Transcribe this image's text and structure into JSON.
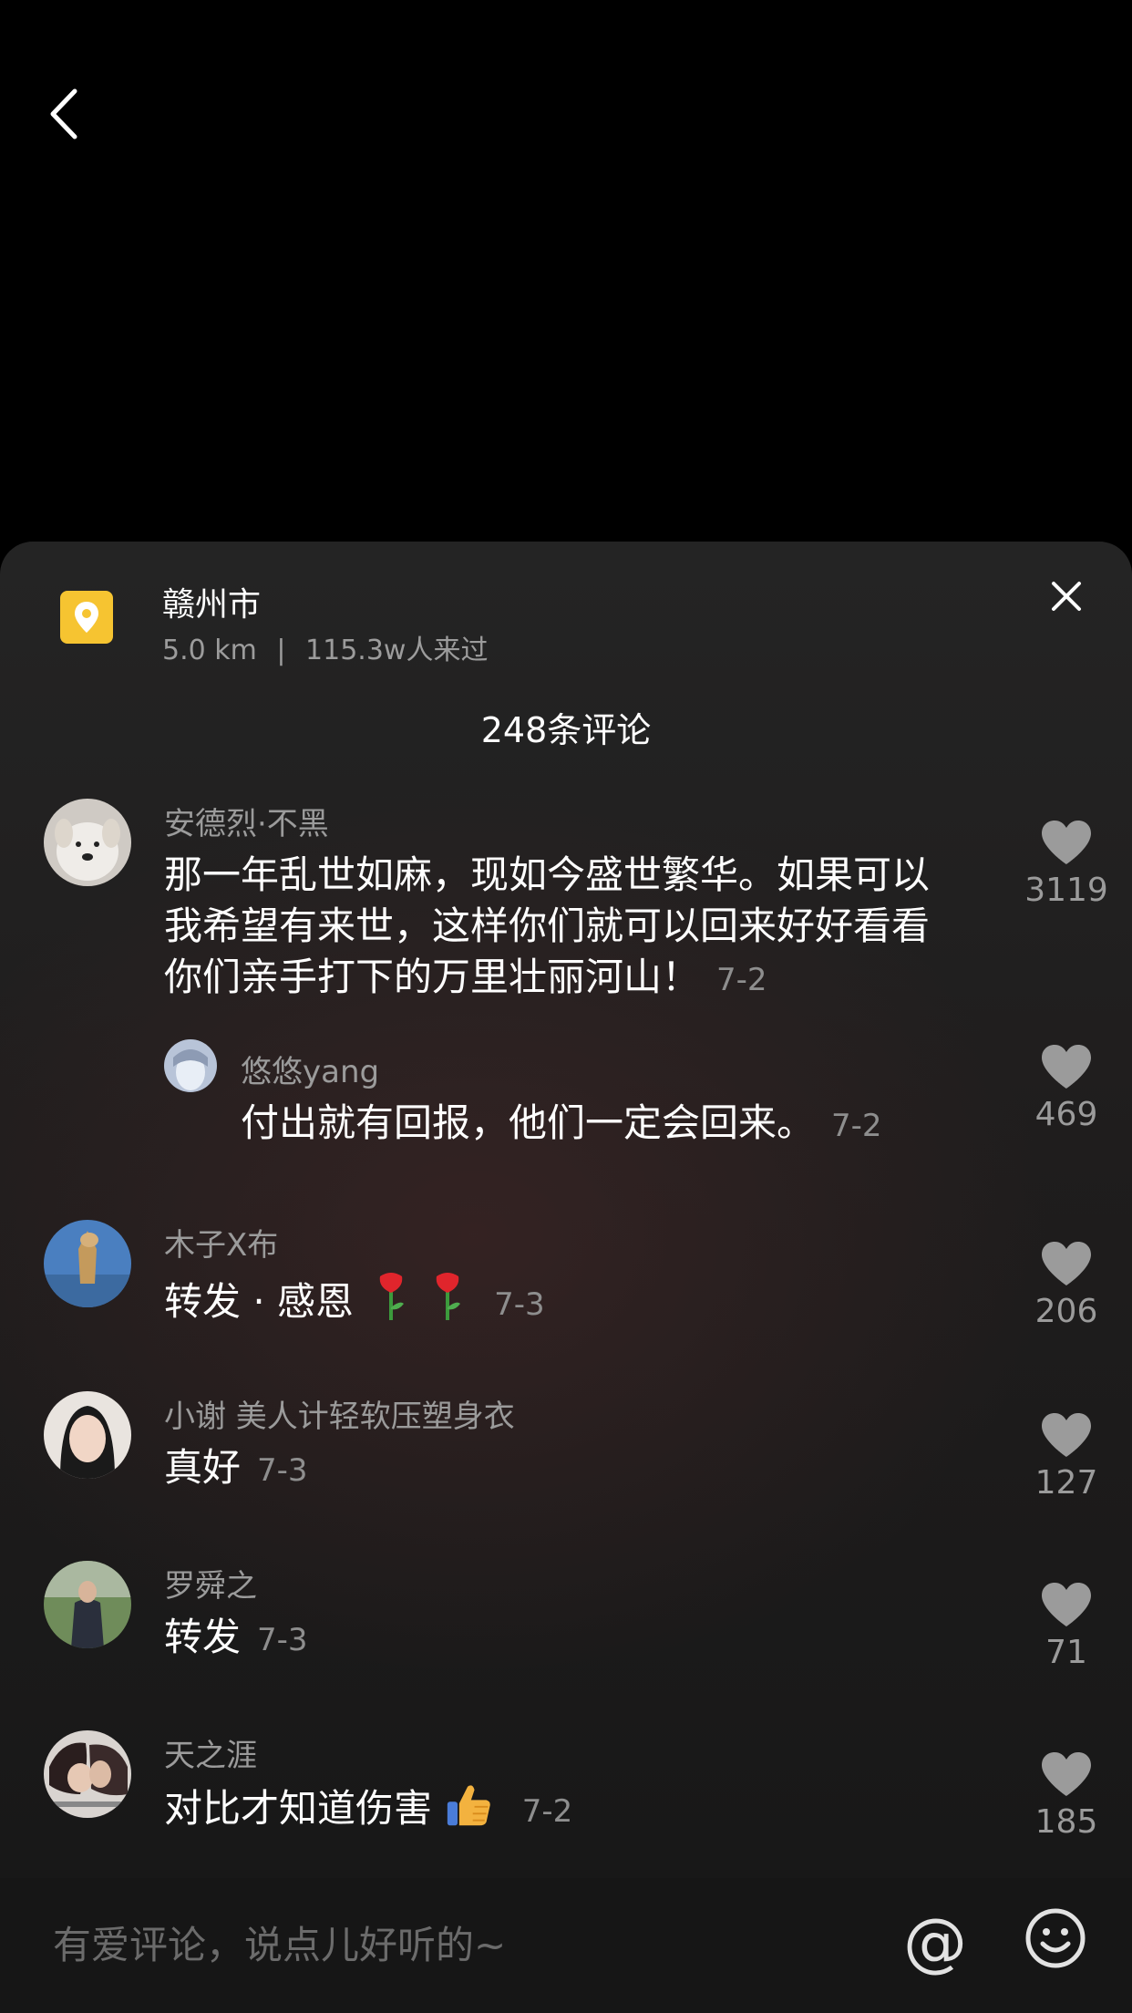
{
  "location": {
    "name": "赣州市",
    "distance": "5.0 km",
    "separator": "|",
    "visits": "115.3w人来过"
  },
  "comments_count": "248条评论",
  "comments": [
    {
      "user": "安德烈·不黑",
      "lines": [
        "那一年乱世如麻，现如今盛世繁华。如果可以",
        "我希望有来世，这样你们就可以回来好好看看",
        "你们亲手打下的万里壮丽河山！"
      ],
      "date": "7-2",
      "likes": "3119"
    },
    {
      "user": "悠悠yang",
      "text": "付出就有回报，他们一定会回来。",
      "date": "7-2",
      "likes": "469",
      "reply": true
    },
    {
      "user": "木子X布",
      "text": "转发 · 感恩",
      "date": "7-3",
      "likes": "206"
    },
    {
      "user": "小谢 美人计轻软压塑身衣",
      "text": "真好",
      "date": "7-3",
      "likes": "127"
    },
    {
      "user": "罗舜之",
      "text": "转发",
      "date": "7-3",
      "likes": "71"
    },
    {
      "user": "天之涯",
      "text": "对比才知道伤害",
      "date": "7-2",
      "likes": "185"
    }
  ],
  "input": {
    "placeholder": "有爱评论，说点儿好听的~"
  },
  "at_symbol": "@",
  "icons": [
    "back-icon",
    "location-icon",
    "close-icon",
    "heart-icon",
    "rose-emoji",
    "thumbs-up-emoji",
    "at-icon",
    "emoji-icon"
  ]
}
